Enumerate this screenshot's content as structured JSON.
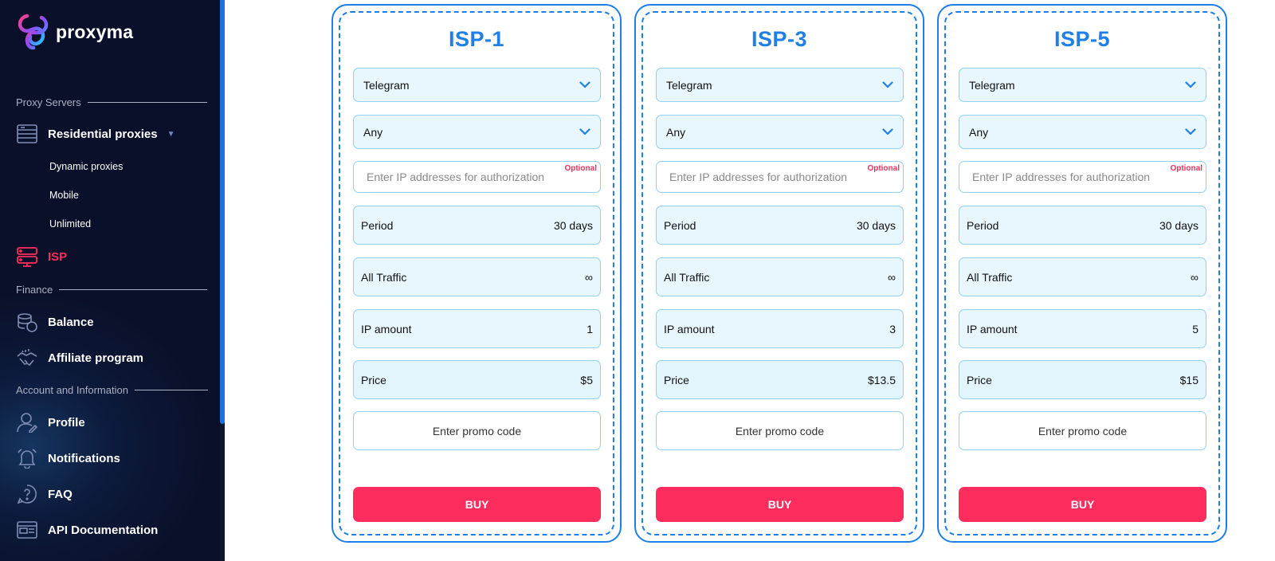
{
  "brand": {
    "name": "proxyma",
    "accent": "#1e7fe8",
    "active": "#ff2d5d",
    "sidebar_bg": "#0a1029"
  },
  "sidebar": {
    "sections": {
      "proxy": "Proxy Servers",
      "finance": "Finance",
      "account": "Account and Information"
    },
    "residential": {
      "label": "Residential proxies",
      "icon": "server-list-icon",
      "sub": [
        "Dynamic proxies",
        "Mobile",
        "Unlimited"
      ]
    },
    "isp": {
      "label": "ISP",
      "icon": "server-rack-icon",
      "active": true
    },
    "balance": {
      "label": "Balance",
      "icon": "coins-icon"
    },
    "affiliate": {
      "label": "Affiliate program",
      "icon": "handshake-icon"
    },
    "profile": {
      "label": "Profile",
      "icon": "user-icon"
    },
    "notifications": {
      "label": "Notifications",
      "icon": "bell-icon"
    },
    "faq": {
      "label": "FAQ",
      "icon": "question-icon"
    },
    "api": {
      "label": "API Documentation",
      "icon": "api-window-icon"
    }
  },
  "labels": {
    "ip_placeholder": "Enter IP addresses for authorization",
    "optional": "Optional",
    "period": "Period",
    "traffic": "All Traffic",
    "ip_amount": "IP amount",
    "price": "Price",
    "promo_placeholder": "Enter promo code",
    "buy": "BUY"
  },
  "cards": [
    {
      "title": "ISP-1",
      "service": "Telegram",
      "location": "Any",
      "period": "30 days",
      "traffic": "∞",
      "ip_amount": "1",
      "price": "$5"
    },
    {
      "title": "ISP-3",
      "service": "Telegram",
      "location": "Any",
      "period": "30 days",
      "traffic": "∞",
      "ip_amount": "3",
      "price": "$13.5"
    },
    {
      "title": "ISP-5",
      "service": "Telegram",
      "location": "Any",
      "period": "30 days",
      "traffic": "∞",
      "ip_amount": "5",
      "price": "$15"
    }
  ]
}
